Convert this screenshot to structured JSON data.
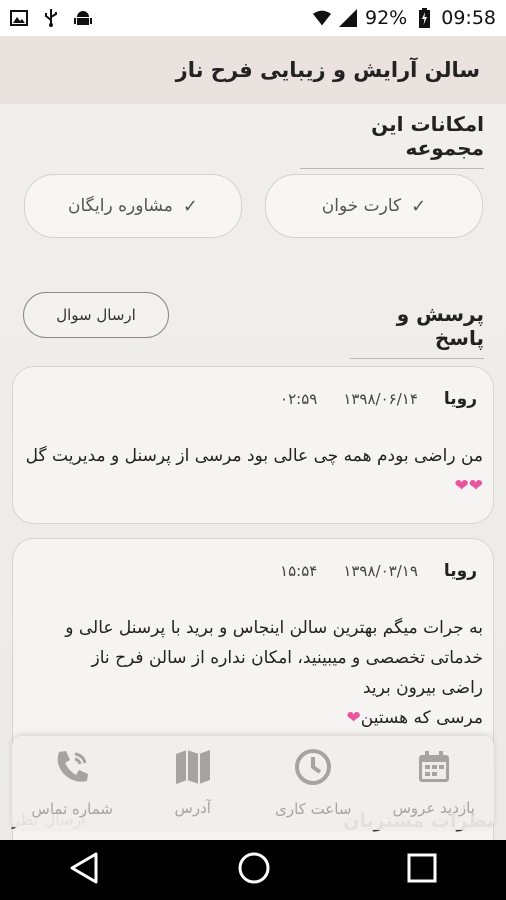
{
  "status_bar": {
    "battery_percent": "92%",
    "time": "09:58",
    "icons": [
      "image-icon",
      "usb-icon",
      "android-icon",
      "wifi-icon",
      "signal-icon",
      "battery-charging-icon"
    ]
  },
  "app_bar": {
    "title": "سالن آرایش و زیبایی فرح ناز"
  },
  "facilities": {
    "title": "امکانات این مجموعه",
    "items": [
      {
        "label": "کارت خوان",
        "icon": "check-icon"
      },
      {
        "label": "مشاوره رایگان",
        "icon": "check-icon"
      }
    ]
  },
  "qa": {
    "title": "پرسش و پاسخ",
    "ask_button": "ارسال سوال",
    "posts": [
      {
        "name": "رویا",
        "date": "۱۳۹۸/۰۶/۱۴",
        "time": "۰۲:۵۹",
        "text": "من  راضی بودم همه چی عالی بود مرسی از پرسنل و مدیریت گل"
      },
      {
        "name": "رویا",
        "date": "۱۳۹۸/۰۳/۱۹",
        "time": "۱۵:۵۴",
        "text_line1": "به جرات میگم بهترین سالن اینجاس و برید با پرسنل عالی و خدماتی تخصصی و میبینید، امکان نداره از سالن فرح ناز",
        "text_line2": "راضی بیرون برید",
        "text_line3": "مرسی که هستین"
      }
    ]
  },
  "reviews_partial": {
    "title": "نظرات مشتریان",
    "button": "ارسال نظر"
  },
  "bottom_nav": [
    {
      "label": "بازدید عروس",
      "icon": "calendar-icon"
    },
    {
      "label": "ساعت کاری",
      "icon": "clock-icon"
    },
    {
      "label": "آدرس",
      "icon": "map-icon"
    },
    {
      "label": "شماره تماس",
      "icon": "phone-icon"
    }
  ],
  "colors": {
    "app_bar_bg": "#e9e2df",
    "heart": "#e8559c",
    "nav_icon": "#a7a3a2"
  }
}
